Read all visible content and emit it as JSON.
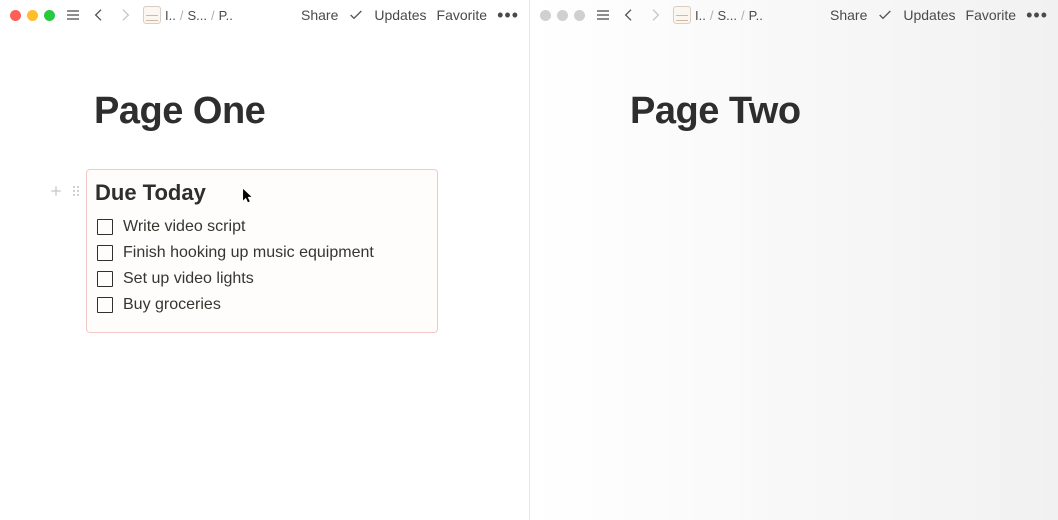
{
  "leftPane": {
    "traffic_active": true,
    "breadcrumb": {
      "part1": "I..",
      "part2": "S...",
      "part3": "P.."
    },
    "toolbar": {
      "share": "Share",
      "updates": "Updates",
      "favorite": "Favorite"
    },
    "page_title": "Page One",
    "block": {
      "heading": "Due Today",
      "todos": [
        "Write video script",
        "Finish hooking up music equipment",
        "Set up video lights",
        "Buy groceries"
      ]
    }
  },
  "rightPane": {
    "traffic_active": false,
    "breadcrumb": {
      "part1": "I..",
      "part2": "S...",
      "part3": "P.."
    },
    "toolbar": {
      "share": "Share",
      "updates": "Updates",
      "favorite": "Favorite"
    },
    "page_title": "Page Two"
  }
}
